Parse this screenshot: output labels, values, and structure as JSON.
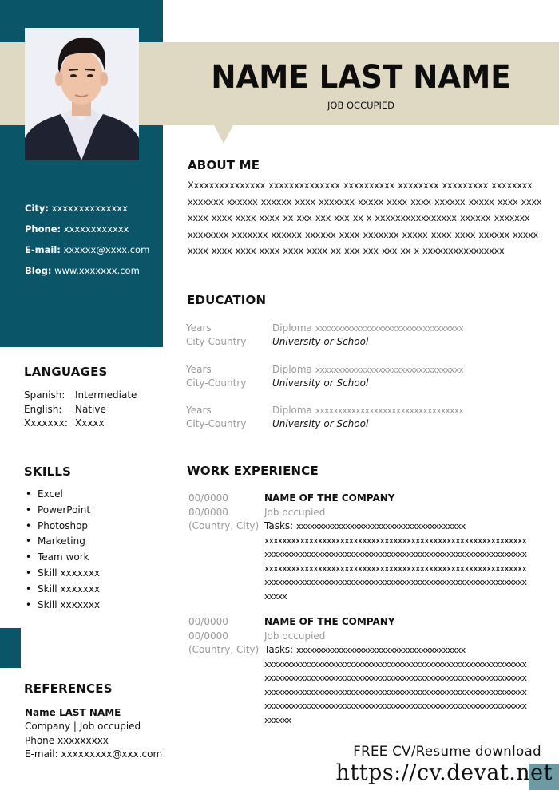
{
  "colors": {
    "teal": "#0a5568",
    "beige": "#dfd9c4",
    "muted_text": "#9a9a9a",
    "corner_block": "#6e9aa4"
  },
  "header": {
    "name": "NAME LAST NAME",
    "job": "JOB OCCUPIED"
  },
  "contact": {
    "city_label": "City:",
    "city_value": "xxxxxxxxxxxxxx",
    "phone_label": "Phone:",
    "phone_value": "xxxxxxxxxxxx",
    "email_label": "E-mail:",
    "email_value": "xxxxxx@xxxx.com",
    "blog_label": "Blog:",
    "blog_value": "www.xxxxxxx.com"
  },
  "about": {
    "title": "ABOUT ME",
    "text": "Xxxxxxxxxxxxxxx xxxxxxxxxxxxxx xxxxxxxxxx xxxxxxxx xxxxxxxxx xxxxxxxx xxxxxxx xxxxxx xxxxxx xxxx xxxxxxx xxxxx xxxx xxxx xxxxxx xxxxx xxxx xxxx xxxx xxxx xxxx xxxx xx xxx xxx xxx xx x xxxxxxxxxxxxxxxx xxxxxx xxxxxxx xxxxxxxx xxxxxxx xxxxxx xxxxxx xxxx xxxxxxx xxxxx xxxx xxxx xxxxxx xxxxx xxxx xxxx xxxx xxxx xxxx xxxx xx xxx xxx xxx xx x xxxxxxxxxxxxxxxx"
  },
  "education": {
    "title": "EDUCATION",
    "items": [
      {
        "years": "Years",
        "location": "City-Country",
        "diploma_label": "Diploma",
        "diploma_value": "xxxxxxxxxxxxxxxxxxxxxxxxxxxxxxxxx",
        "school": "University or School"
      },
      {
        "years": "Years",
        "location": "City-Country",
        "diploma_label": "Diploma",
        "diploma_value": "xxxxxxxxxxxxxxxxxxxxxxxxxxxxxxxxx",
        "school": "University or School"
      },
      {
        "years": "Years",
        "location": "City-Country",
        "diploma_label": "Diploma",
        "diploma_value": "xxxxxxxxxxxxxxxxxxxxxxxxxxxxxxxxx",
        "school": "University or School"
      }
    ]
  },
  "languages": {
    "title": "LANGUAGES",
    "items": [
      {
        "language": "Spanish:",
        "level": "Intermediate"
      },
      {
        "language": "English:",
        "level": "Native"
      },
      {
        "language": "Xxxxxxx:",
        "level": "Xxxxx"
      }
    ]
  },
  "skills": {
    "title": "SKILLS",
    "bullet": "•",
    "items": [
      "Excel",
      "PowerPoint",
      "Photoshop",
      "Marketing",
      "Team work",
      "Skill xxxxxxx",
      "Skill xxxxxxx",
      "Skill xxxxxxx"
    ]
  },
  "work": {
    "title": "WORK EXPERIENCE",
    "items": [
      {
        "start": "00/0000",
        "end": "00/0000",
        "location": "(Country, City)",
        "company": "NAME OF THE COMPANY",
        "job": "Job occupied",
        "tasks_label": "Tasks:",
        "tasks_first": "xxxxxxxxxxxxxxxxxxxxxxxxxxxxxxxxxxxxxx",
        "tasks_lines": [
          "xxxxxxxxxxxxxxxxxxxxxxxxxxxxxxxxxxxxxxxxxxxxxxxxxxxxxxxxxxx",
          "xxxxxxxxxxxxxxxxxxxxxxxxxxxxxxxxxxxxxxxxxxxxxxxxxxxxxxxxxxx",
          "xxxxxxxxxxxxxxxxxxxxxxxxxxxxxxxxxxxxxxxxxxxxxxxxxxxxxxxxxxx",
          "xxxxxxxxxxxxxxxxxxxxxxxxxxxxxxxxxxxxxxxxxxxxxxxxxxxxxxxxxxx",
          "xxxxx"
        ]
      },
      {
        "start": "00/0000",
        "end": "00/0000",
        "location": "(Country, City)",
        "company": "NAME OF THE COMPANY",
        "job": "Job occupied",
        "tasks_label": "Tasks:",
        "tasks_first": "xxxxxxxxxxxxxxxxxxxxxxxxxxxxxxxxxxxxxx",
        "tasks_lines": [
          "xxxxxxxxxxxxxxxxxxxxxxxxxxxxxxxxxxxxxxxxxxxxxxxxxxxxxxxxxxx",
          "xxxxxxxxxxxxxxxxxxxxxxxxxxxxxxxxxxxxxxxxxxxxxxxxxxxxxxxxxxx",
          "xxxxxxxxxxxxxxxxxxxxxxxxxxxxxxxxxxxxxxxxxxxxxxxxxxxxxxxxxxx",
          "xxxxxxxxxxxxxxxxxxxxxxxxxxxxxxxxxxxxxxxxxxxxxxxxxxxxxxxxxxx",
          "xxxxxx"
        ]
      }
    ]
  },
  "references": {
    "title": "REFERENCES",
    "name": "Name LAST NAME",
    "company": "Company | Job occupied",
    "phone": "Phone xxxxxxxxx",
    "email": "E-mail: xxxxxxxxx@xxx.com"
  },
  "promo": {
    "text": "FREE CV/Resume download",
    "url": "https://cv.devat.net"
  }
}
